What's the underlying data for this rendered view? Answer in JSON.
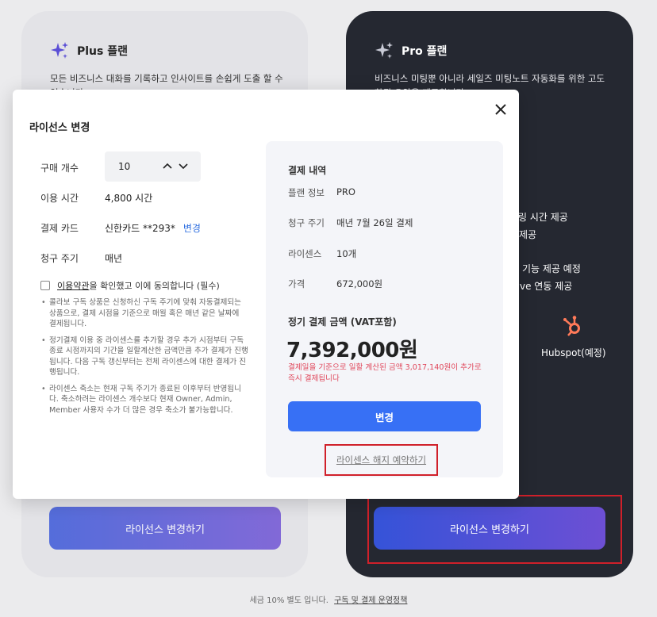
{
  "plus_card": {
    "name": "Plus 플랜",
    "description": "모든 비즈니스 대화를 기록하고 인사이트를 손쉽게 도출 할 수 있습니다",
    "button": "라이선스 변경하기"
  },
  "pro_card": {
    "name": "Pro 플랜",
    "description": "비즈니스 미팅뿐 아니라 세일즈 미팅노트 자동화를 위한 고도화된 요약을 제공합니다",
    "feature_1": "링 시간 제공",
    "feature_2": "제공",
    "feature_3": "기능 제공 예정",
    "feature_4": "ve 연동 제공",
    "integration_partial": ")",
    "integration": "Hubspot(예정)",
    "button": "라이선스 변경하기"
  },
  "footer": {
    "text": "세금 10% 별도 입니다.",
    "link": "구독 및 결제 운영정책"
  },
  "modal": {
    "title": "라이선스 변경",
    "fields": {
      "quantity_label": "구매 개수",
      "quantity_value": "10",
      "usage_label": "이용 시간",
      "usage_value": "4,800 시간",
      "card_label": "결제 카드",
      "card_value": "신한카드 **293*",
      "card_change": "변경",
      "cycle_label": "청구 주기",
      "cycle_value": "매년"
    },
    "agree": {
      "link": "이용약관",
      "text": "을 확인했고 이에 동의합니다 (필수)"
    },
    "notes": [
      "콜라보 구독 상품은 신청하신 구독 주기에 맞춰 자동결제되는 상품으로, 결제 시점을 기준으로 매월 혹은 매년 같은 날짜에 결제됩니다.",
      "정기결제 이용 중 라이센스를 추가할 경우 추가 시점부터 구독 종료 시점까지의 기간을 일할계산한 금액만큼 추가 결제가 진행됩니다. 다음 구독 갱신부터는 전체 라이센스에 대한 결제가 진행됩니다.",
      "라이센스 축소는 현재 구독 주기가 종료된 이후부터 반영됩니다. 축소하려는 라이센스 개수보다 현재 Owner, Admin, Member 사용자 수가 더 많은 경우 축소가 불가능합니다."
    ],
    "summary": {
      "title": "결제 내역",
      "plan_label": "플랜 정보",
      "plan_value": "PRO",
      "cycle_label": "청구 주기",
      "cycle_value": "매년 7월 26일 결제",
      "license_label": "라이센스",
      "license_value": "10개",
      "price_label": "가격",
      "price_value": "672,000원",
      "total_label": "정기 결제 금액 (VAT포함)",
      "total_value": "7,392,000원",
      "notice": "결제일을 기준으로 일할 계산된 금액 3,017,140원이 추가로 즉시 결제됩니다",
      "submit": "변경",
      "cancel": "라이센스 해지 예약하기"
    }
  },
  "colors": {
    "accent": "#3770f5",
    "warning": "#e0475b",
    "highlight_box": "#d0202a",
    "pro_card_bg": "#252831"
  }
}
